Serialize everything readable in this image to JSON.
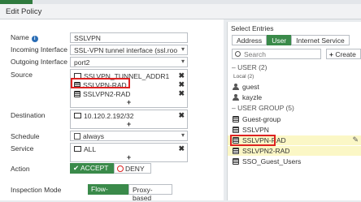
{
  "window": {
    "title": "Edit Policy"
  },
  "form": {
    "name_label": "Name",
    "name_value": "SSLVPN",
    "incoming_label": "Incoming Interface",
    "incoming_value": "SSL-VPN tunnel interface (ssl.roo",
    "outgoing_label": "Outgoing Interface",
    "outgoing_value": "port2",
    "source_label": "Source",
    "source_entries": [
      "SSLVPN_TUNNEL_ADDR1",
      "SSLVPN-RAD",
      "SSLVPN2-RAD"
    ],
    "destination_label": "Destination",
    "destination_value": "10.120.2.192/32",
    "schedule_label": "Schedule",
    "schedule_value": "always",
    "service_label": "Service",
    "service_value": "ALL",
    "action_label": "Action",
    "accept_label": "ACCEPT",
    "deny_label": "DENY",
    "inspection_label": "Inspection Mode",
    "flow_label": "Flow-based",
    "proxy_label": "Proxy-based"
  },
  "panel": {
    "title": "Select Entries",
    "tabs": [
      "Address",
      "User",
      "Internet Service"
    ],
    "active_tab": "User",
    "search_placeholder": "Search",
    "create_label": "Create",
    "user_group_header": "USER (2)",
    "local_label": "Local (2)",
    "users": [
      "guest",
      "kayzle"
    ],
    "usergroup_header": "USER GROUP (5)",
    "groups": [
      "Guest-group",
      "SSLVPN",
      "SSLVPN-RAD",
      "SSLVPN2-RAD",
      "SSO_Guest_Users"
    ]
  },
  "colors": {
    "accent": "#3a8a4a",
    "highlight_box": "#dd2222",
    "row_highlight": "#fbf7c6"
  }
}
